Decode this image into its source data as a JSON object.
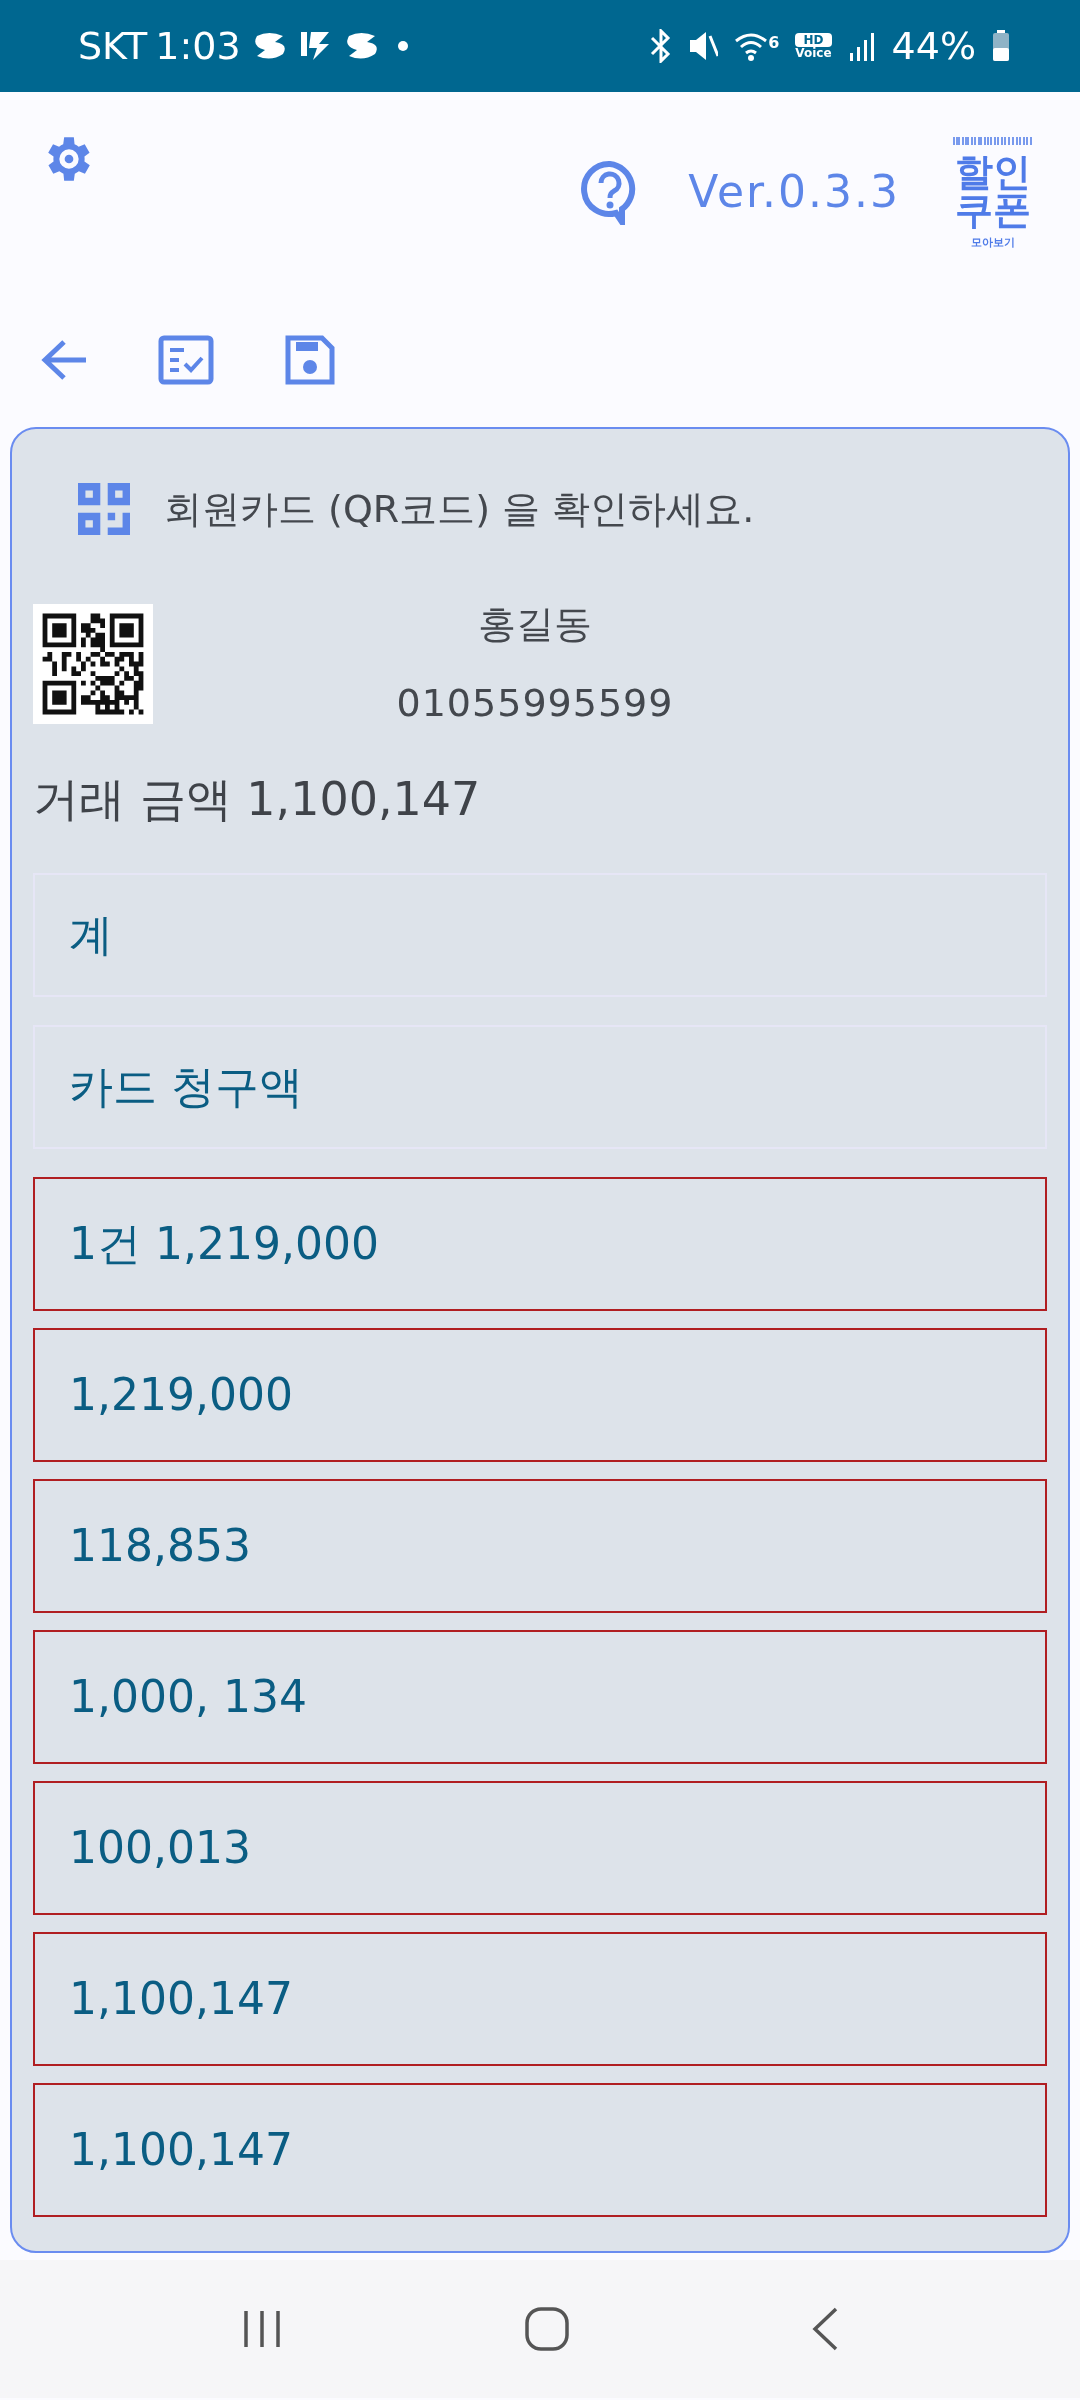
{
  "status_bar": {
    "carrier": "SKT",
    "time": "1:03",
    "wifi_badge": "6",
    "hd": "HD",
    "voice": "Voice",
    "battery": "44%"
  },
  "header": {
    "version": "Ver.0.3.3",
    "logo": {
      "line_1": "할인",
      "line_2": "쿠폰",
      "caption": "모아보기"
    }
  },
  "card": {
    "prompt": "회원카드 (QR코드) 을 확인하세요.",
    "member_name": "홍길동",
    "phone": "01055995599",
    "amount": "거래 금액 1,100,147",
    "fields": [
      {
        "text": "계",
        "error": false
      },
      {
        "text": "카드 청구액",
        "error": false
      },
      {
        "text": "1건 1,219,000",
        "error": true
      },
      {
        "text": "1,219,000",
        "error": true
      },
      {
        "text": "118,853",
        "error": true
      },
      {
        "text": "1,000, 134",
        "error": true
      },
      {
        "text": "100,013",
        "error": true
      },
      {
        "text": "1,100,147",
        "error": true
      },
      {
        "text": "1,100,147",
        "error": true
      }
    ]
  }
}
